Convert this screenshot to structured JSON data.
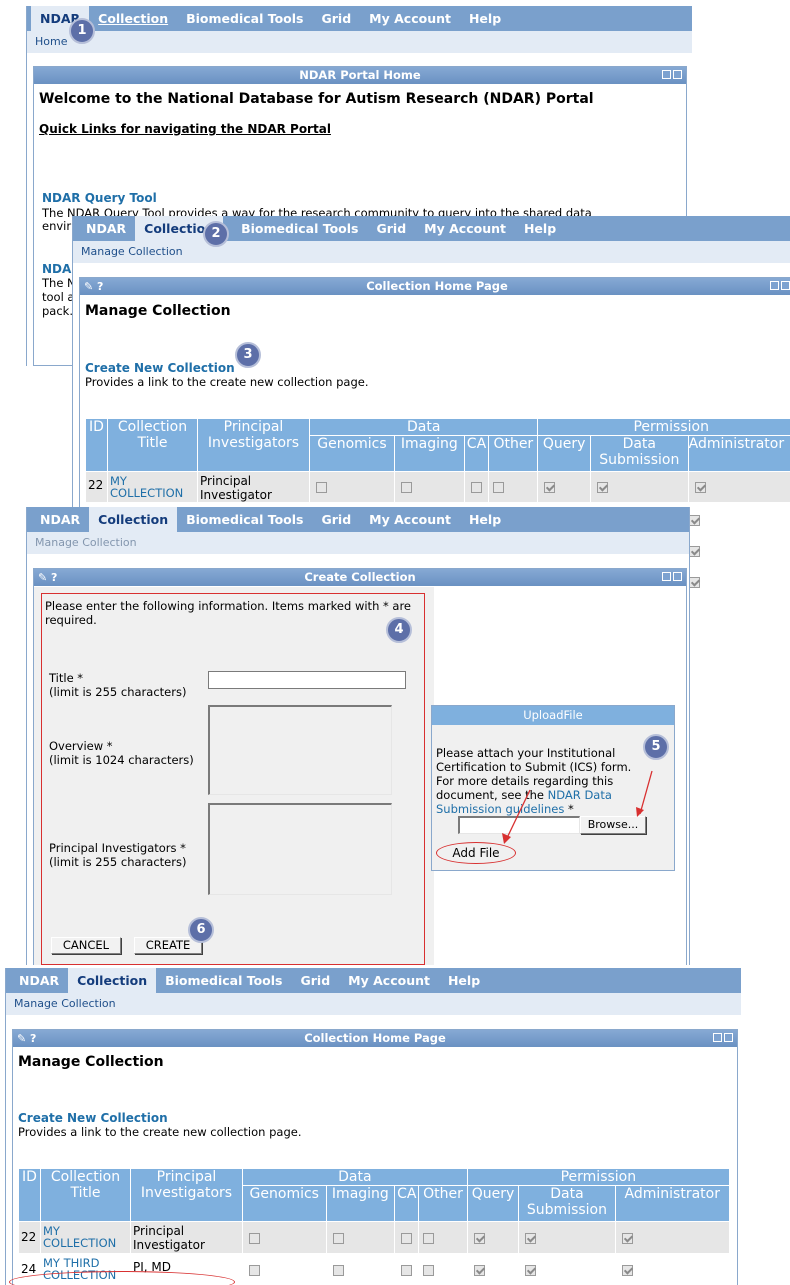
{
  "nav_items": [
    "NDAR",
    "Collection",
    "Biomedical Tools",
    "Grid",
    "My Account",
    "Help"
  ],
  "breadcrumb_home": "Home",
  "breadcrumb_manage": "Manage Collection",
  "badges": [
    "1",
    "2",
    "3",
    "4",
    "5",
    "6"
  ],
  "screen1": {
    "panel_title": "NDAR Portal Home",
    "welcome": "Welcome to the National Database for Autism Research (NDAR) Portal",
    "quick_links": "Quick Links for navigating the NDAR Portal",
    "query_tool_link": "NDAR Query Tool",
    "query_tool_desc": "The NDAR Query Tool provides a way for the research community to query into the shared data",
    "query_tool_desc2": "envir",
    "second_link": "NDAR",
    "frag1": "The N",
    "frag2": "tool a",
    "frag3": "pack."
  },
  "collection_home": {
    "panel_title": "Collection Home Page",
    "icons": "✎ ?",
    "heading": "Manage Collection",
    "create_link": "Create New Collection",
    "create_desc": "Provides a link to the create new collection page.",
    "headers": {
      "id": "ID",
      "title_l1": "Collection",
      "title_l2": "Title",
      "pi_l1": "Principal",
      "pi_l2": "Investigators",
      "data": "Data",
      "permission": "Permission",
      "genomics": "Genomics",
      "imaging": "Imaging",
      "ca": "CA",
      "other": "Other",
      "query": "Query",
      "submission_l1": "Data",
      "submission_l2": "Submission",
      "admin": "Administrator"
    },
    "rows": [
      {
        "id": "22",
        "title_l1": "MY",
        "title_l2": "COLLECTION",
        "pi_l1": "Principal",
        "pi_l2": "Investigator"
      },
      {
        "id": "24",
        "title_l1": "MY THIRD",
        "title_l2": "COLLECTION",
        "pi_l1": "PI, MD",
        "pi_l2": ""
      }
    ]
  },
  "create_collection": {
    "panel_title": "Create Collection",
    "instructions": "Please enter the following information. Items marked with * are required.",
    "title_label": "Title *",
    "title_limit": "(limit is 255 characters)",
    "overview_label": "Overview *",
    "overview_limit": "(limit is 1024 characters)",
    "pi_label": "Principal Investigators *",
    "pi_limit": "(limit is 255 characters)",
    "cancel": "CANCEL",
    "create": "CREATE"
  },
  "upload": {
    "title": "UploadFile",
    "text1": "Please attach your Institutional Certification to Submit (ICS) form. For more details regarding this document, see the ",
    "link": "NDAR Data Submission guidelines",
    "text2": " *",
    "browse": "Browse...",
    "add_file": "Add File"
  },
  "colors": {
    "nav": "#7aa0cc",
    "subnav": "#e3ebf5",
    "table_header": "#7fb0de",
    "link": "#1f6fa8",
    "badge": "#5d6fa8",
    "highlight": "#d83030"
  }
}
